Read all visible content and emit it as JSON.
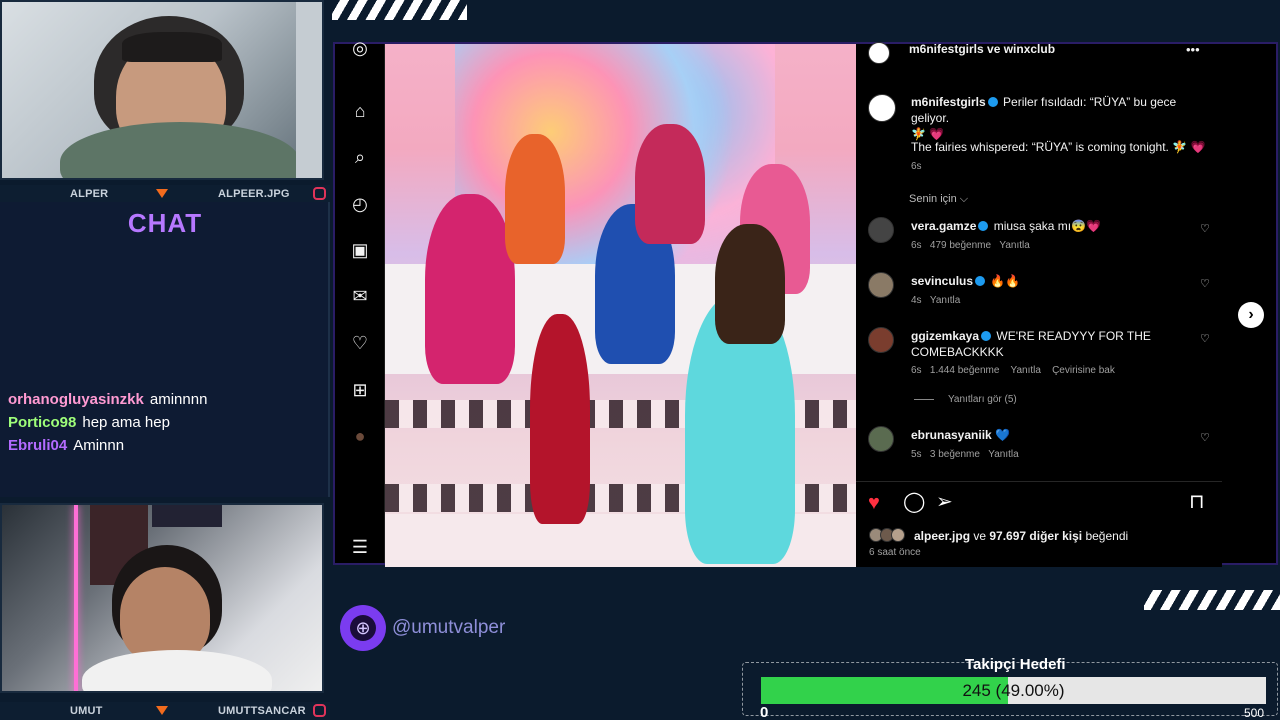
{
  "webcams": {
    "top": {
      "left_name": "ALPER",
      "right_name": "ALPEER.JPG"
    },
    "bottom": {
      "left_name": "UMUT",
      "right_name": "UMUTTSANCAR"
    }
  },
  "chat": {
    "title": "CHAT",
    "messages": [
      {
        "user": "orhanogluyasinzkk",
        "text": "aminnnn",
        "color": "#ff9ad2"
      },
      {
        "user": "Portico98",
        "text": "hep ama hep",
        "color": "#9fff7a"
      },
      {
        "user": "Ebruli04",
        "text": "Aminnn",
        "color": "#b36bff"
      }
    ]
  },
  "post": {
    "header": {
      "accounts": "m6nifestgirls ve winxclub",
      "more_label": "•••"
    },
    "caption": {
      "user": "m6nifestgirls",
      "line1": "Periler fısıldadı: “RÜYA” bu gece geliyor.",
      "line1_emoji": "🧚 💗",
      "line2": "The fairies whispered: “RÜYA” is coming tonight. 🧚 💗",
      "time": "6s"
    },
    "sort_label": "Senin için ⌵",
    "comments": [
      {
        "user": "vera.gamze",
        "text": "miusa şaka mı😨💗",
        "time": "6s",
        "likes": "479 beğenme",
        "reply": "Yanıtla",
        "extra": ""
      },
      {
        "user": "sevinculus",
        "text": "🔥🔥",
        "time": "4s",
        "likes": "",
        "reply": "Yanıtla",
        "extra": ""
      },
      {
        "user": "ggizemkaya",
        "text": "WE'RE READYYY FOR THE COMEBACKKKK",
        "time": "6s",
        "likes": "1.444 beğenme",
        "reply": "Yanıtla",
        "extra": "Çevirisine bak"
      },
      {
        "user": "ebrunasyaniik",
        "text": "💙",
        "time": "5s",
        "likes": "3 beğenme",
        "reply": "Yanıtla",
        "extra": ""
      }
    ],
    "view_replies": "Yanıtları gör (5)",
    "likes_text": {
      "user": "alpeer.jpg",
      "middle": " ve ",
      "count": "97.697 diğer kişi",
      "suffix": " beğendi"
    },
    "posted": "6 saat önce",
    "next_label": "›"
  },
  "rail_icons": [
    "instagram-icon",
    "home-icon",
    "search-icon",
    "explore-icon",
    "reels-icon",
    "messages-icon",
    "notifications-icon",
    "create-icon",
    "profile-icon",
    "menu-icon"
  ],
  "social": {
    "handle": "@umutvalper"
  },
  "follower_goal": {
    "title": "Takipçi Hedefi",
    "current": 245,
    "percent_label": "245 (49.00%)",
    "fraction": 0.49,
    "min_label": "0",
    "max_label": "500"
  },
  "colors": {
    "accent_purple": "#b678ff",
    "goal_green": "#32d24b",
    "like_red": "#ff3040"
  }
}
